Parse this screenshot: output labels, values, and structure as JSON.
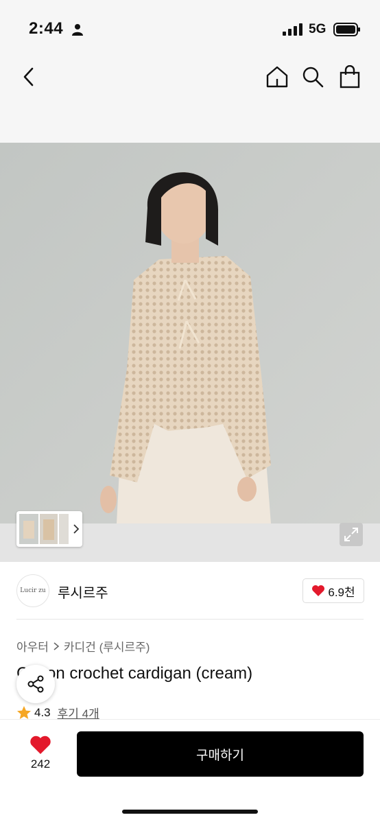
{
  "status_bar": {
    "time": "2:44",
    "network": "5G"
  },
  "nav": {
    "back_icon": "chevron-left-icon",
    "home_icon": "home-icon",
    "search_icon": "search-icon",
    "cart_icon": "shopping-bag-icon"
  },
  "brand": {
    "logo_text": "Lucir zu",
    "name": "루시르주",
    "likes": "6.9천"
  },
  "breadcrumb": {
    "category": "아우터",
    "subcategory": "카디건 (루시르주)"
  },
  "product": {
    "title": "Cotton crochet cardigan (cream)",
    "rating": "4.3",
    "reviews": "후기 4개"
  },
  "bottom": {
    "wish_count": "242",
    "buy_label": "구매하기"
  },
  "colors": {
    "accent_red": "#e3192c",
    "buy_button": "#000000",
    "star": "#f5a623"
  }
}
